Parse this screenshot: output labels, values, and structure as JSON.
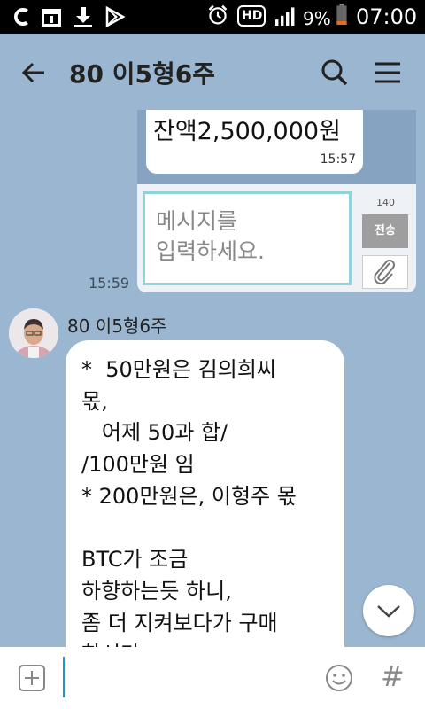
{
  "status_bar": {
    "battery_percent": "9%",
    "time": "07:00",
    "hd_label": "HD",
    "icons": [
      "opera-icon",
      "calendar-icon",
      "download-icon",
      "play-store-icon",
      "alarm-icon",
      "hd-voice-icon",
      "signal-icon",
      "battery-icon"
    ]
  },
  "header": {
    "title": "80 이5형6주"
  },
  "messages": {
    "shared_image": {
      "balance_text": "잔액2,500,000원",
      "inner_time": "15:57",
      "input_placeholder": "메시지를\n입력하세요.",
      "char_count": "140",
      "send_label": "전송"
    },
    "image_time": "15:59",
    "incoming": {
      "sender": "80 이5형6주",
      "text": "*  50만원은 김의희씨\n몫,\n   어제 50과 합/\n/100만원 임\n* 200만원은, 이형주 몫\n\nBTC가 조금\n하향하는듯 하니,\n좀 더 지켜보다가 구매\n한시다"
    }
  },
  "input_bar": {
    "placeholder": "",
    "hash_label": "#"
  },
  "colors": {
    "chat_background": "#9bb6d0",
    "status_bar": "#000000",
    "caret": "#2196c9"
  }
}
